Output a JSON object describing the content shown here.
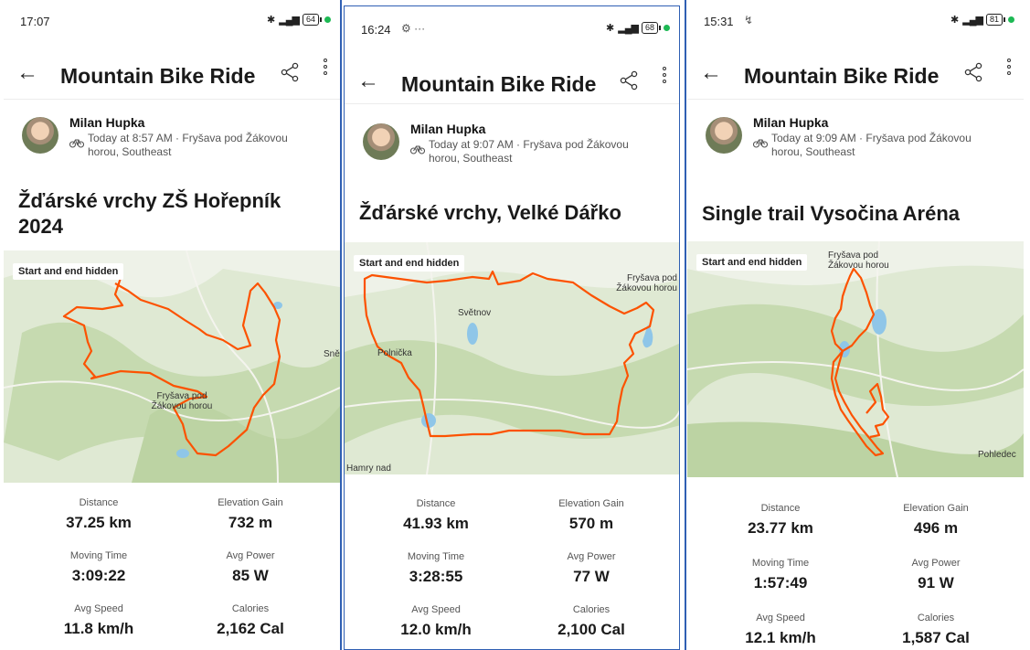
{
  "panels": [
    {
      "status": {
        "time": "17:07",
        "extra": "",
        "battery": "64"
      },
      "app_bar": {
        "title": "Mountain Bike Ride"
      },
      "athlete": {
        "name": "Milan Hupka",
        "meta": "Today at 8:57 AM · Fryšava pod Žákovou horou, Southeast"
      },
      "activity_name": "Žďárské vrchy ZŠ Hořepník 2024",
      "map": {
        "label": "Start and end hidden",
        "places": [
          "Fryšava pod Žákovou horou",
          "Sně"
        ]
      },
      "stats": [
        {
          "label": "Distance",
          "value": "37.25 km"
        },
        {
          "label": "Elevation Gain",
          "value": "732 m"
        },
        {
          "label": "Moving Time",
          "value": "3:09:22"
        },
        {
          "label": "Avg Power",
          "value": "85 W"
        },
        {
          "label": "Avg Speed",
          "value": "11.8 km/h"
        },
        {
          "label": "Calories",
          "value": "2,162 Cal"
        }
      ]
    },
    {
      "status": {
        "time": "16:24",
        "extra": "⚙ ···",
        "battery": "68"
      },
      "app_bar": {
        "title": "Mountain Bike Ride"
      },
      "athlete": {
        "name": "Milan Hupka",
        "meta": "Today at 9:07 AM · Fryšava pod Žákovou horou, Southeast"
      },
      "activity_name": "Žďárské vrchy, Velké Dářko",
      "map": {
        "label": "Start and end hidden",
        "places": [
          "Světnov",
          "Fryšava pod Žákovou horou",
          "Polnička",
          "Hamry nad"
        ]
      },
      "stats": [
        {
          "label": "Distance",
          "value": "41.93 km"
        },
        {
          "label": "Elevation Gain",
          "value": "570 m"
        },
        {
          "label": "Moving Time",
          "value": "3:28:55"
        },
        {
          "label": "Avg Power",
          "value": "77 W"
        },
        {
          "label": "Avg Speed",
          "value": "12.0 km/h"
        },
        {
          "label": "Calories",
          "value": "2,100 Cal"
        }
      ]
    },
    {
      "status": {
        "time": "15:31",
        "extra": "↯",
        "battery": "81"
      },
      "app_bar": {
        "title": "Mountain Bike Ride"
      },
      "athlete": {
        "name": "Milan Hupka",
        "meta": "Today at 9:09 AM · Fryšava pod Žákovou horou, Southeast"
      },
      "activity_name": "Single trail Vysočina Aréna",
      "map": {
        "label": "Start and end hidden",
        "places": [
          "Fryšava pod Žákovou horou",
          "Pohledec"
        ]
      },
      "stats": [
        {
          "label": "Distance",
          "value": "23.77 km"
        },
        {
          "label": "Elevation Gain",
          "value": "496 m"
        },
        {
          "label": "Moving Time",
          "value": "1:57:49"
        },
        {
          "label": "Avg Power",
          "value": "91 W"
        },
        {
          "label": "Avg Speed",
          "value": "12.1 km/h"
        },
        {
          "label": "Calories",
          "value": "1,587 Cal"
        }
      ]
    }
  ],
  "icons": [
    "back-arrow-icon",
    "share-icon",
    "more-vertical-icon",
    "bluetooth-icon",
    "signal-icon",
    "battery-icon",
    "bike-icon",
    "avatar"
  ],
  "colors": {
    "route": "#fc5200",
    "map_green": "#c9dcb4",
    "map_water": "#8fc6e8",
    "frame": "#2f5fb3",
    "status_dot": "#1db954"
  }
}
